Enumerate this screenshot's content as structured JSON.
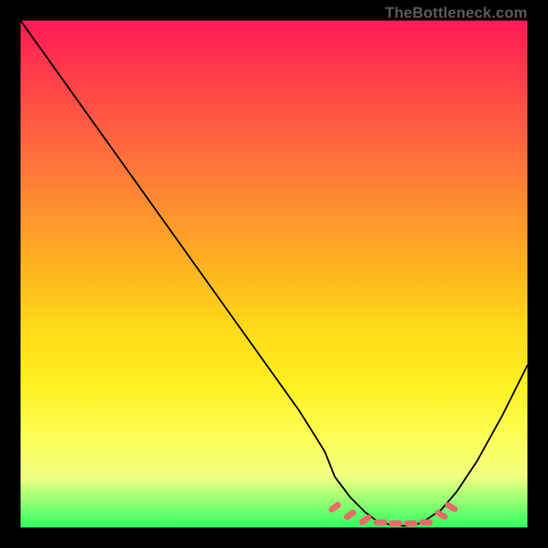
{
  "watermark": "TheBottleneck.com",
  "chart_data": {
    "type": "line",
    "title": "",
    "xlabel": "",
    "ylabel": "",
    "xlim": [
      0,
      100
    ],
    "ylim": [
      0,
      100
    ],
    "grid": false,
    "series": [
      {
        "name": "bottleneck-curve",
        "x": [
          0,
          5,
          10,
          15,
          20,
          25,
          30,
          35,
          40,
          45,
          50,
          55,
          60,
          62,
          65,
          68,
          70,
          73,
          76,
          78,
          80,
          83,
          86,
          90,
          95,
          100
        ],
        "y": [
          100,
          93,
          86,
          79,
          72,
          65,
          58,
          51,
          44,
          37,
          30,
          23,
          15,
          10,
          6,
          3,
          1.5,
          0.5,
          0.3,
          0.5,
          1.5,
          3.5,
          7,
          13,
          22,
          32
        ]
      }
    ],
    "markers": [
      {
        "name": "valley-marker",
        "x": 62,
        "y": 4
      },
      {
        "name": "valley-marker",
        "x": 65,
        "y": 2.5
      },
      {
        "name": "valley-marker",
        "x": 68,
        "y": 1.5
      },
      {
        "name": "valley-marker",
        "x": 71,
        "y": 1
      },
      {
        "name": "valley-marker",
        "x": 74,
        "y": 0.8
      },
      {
        "name": "valley-marker",
        "x": 77,
        "y": 0.8
      },
      {
        "name": "valley-marker",
        "x": 80,
        "y": 1
      },
      {
        "name": "valley-marker",
        "x": 83,
        "y": 2.5
      },
      {
        "name": "valley-marker",
        "x": 85,
        "y": 4
      }
    ],
    "marker_color": "#e86a6a",
    "curve_color": "#000000"
  }
}
